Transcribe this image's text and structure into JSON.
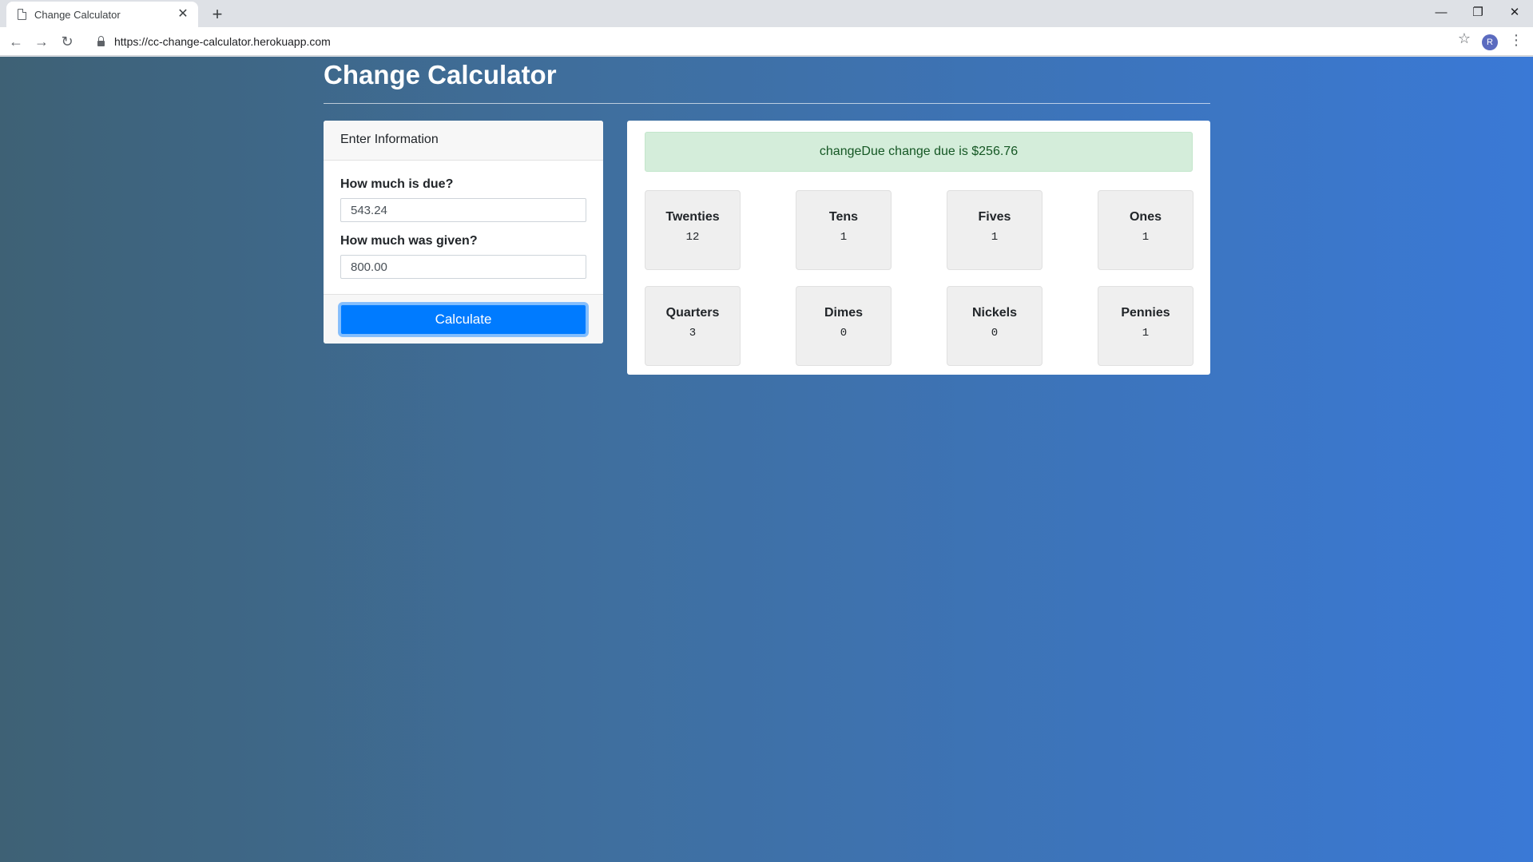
{
  "browser": {
    "tab_title": "Change Calculator",
    "tab_close": "✕",
    "new_tab": "+",
    "url": "https://cc-change-calculator.herokuapp.com",
    "profile_initial": "R"
  },
  "page": {
    "title": "Change Calculator"
  },
  "form": {
    "header": "Enter Information",
    "due_label": "How much is due?",
    "due_value": "543.24",
    "given_label": "How much was given?",
    "given_value": "800.00",
    "button_label": "Calculate"
  },
  "result": {
    "message": "changeDue change due is $256.76",
    "denominations": [
      {
        "name": "Twenties",
        "count": "12"
      },
      {
        "name": "Tens",
        "count": "1"
      },
      {
        "name": "Fives",
        "count": "1"
      },
      {
        "name": "Ones",
        "count": "1"
      },
      {
        "name": "Quarters",
        "count": "3"
      },
      {
        "name": "Dimes",
        "count": "0"
      },
      {
        "name": "Nickels",
        "count": "0"
      },
      {
        "name": "Pennies",
        "count": "1"
      }
    ]
  },
  "colors": {
    "primary_button": "#007bff",
    "alert_bg": "#d4edda",
    "alert_text": "#155724",
    "gradient_start": "#3e6175",
    "gradient_end": "#3a79d6"
  }
}
